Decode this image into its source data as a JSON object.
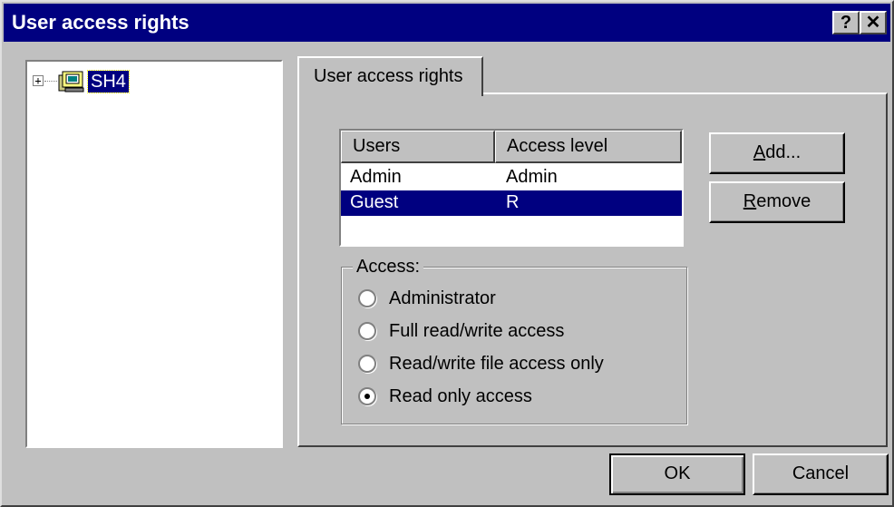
{
  "window": {
    "title": "User access rights",
    "help_label": "?",
    "close_label": "✕"
  },
  "tree": {
    "expander": "+",
    "node_label": "SH4"
  },
  "tab": {
    "label": "User access rights"
  },
  "list": {
    "headers": [
      "Users",
      "Access level"
    ],
    "rows": [
      {
        "user": "Admin",
        "level": "Admin",
        "selected": false
      },
      {
        "user": "Guest",
        "level": "R",
        "selected": true
      }
    ]
  },
  "buttons": {
    "add": {
      "mnemonic": "A",
      "rest": "dd..."
    },
    "remove": {
      "mnemonic": "R",
      "rest": "emove"
    },
    "ok": "OK",
    "cancel": "Cancel"
  },
  "access_group": {
    "label": "Access:",
    "options": [
      {
        "label": "Administrator",
        "selected": false
      },
      {
        "label": "Full read/write access",
        "selected": false
      },
      {
        "label": "Read/write file access only",
        "selected": false
      },
      {
        "label": "Read only access",
        "selected": true
      }
    ]
  },
  "colors": {
    "titlebar": "#000080",
    "selection": "#000080",
    "face": "#c0c0c0"
  }
}
